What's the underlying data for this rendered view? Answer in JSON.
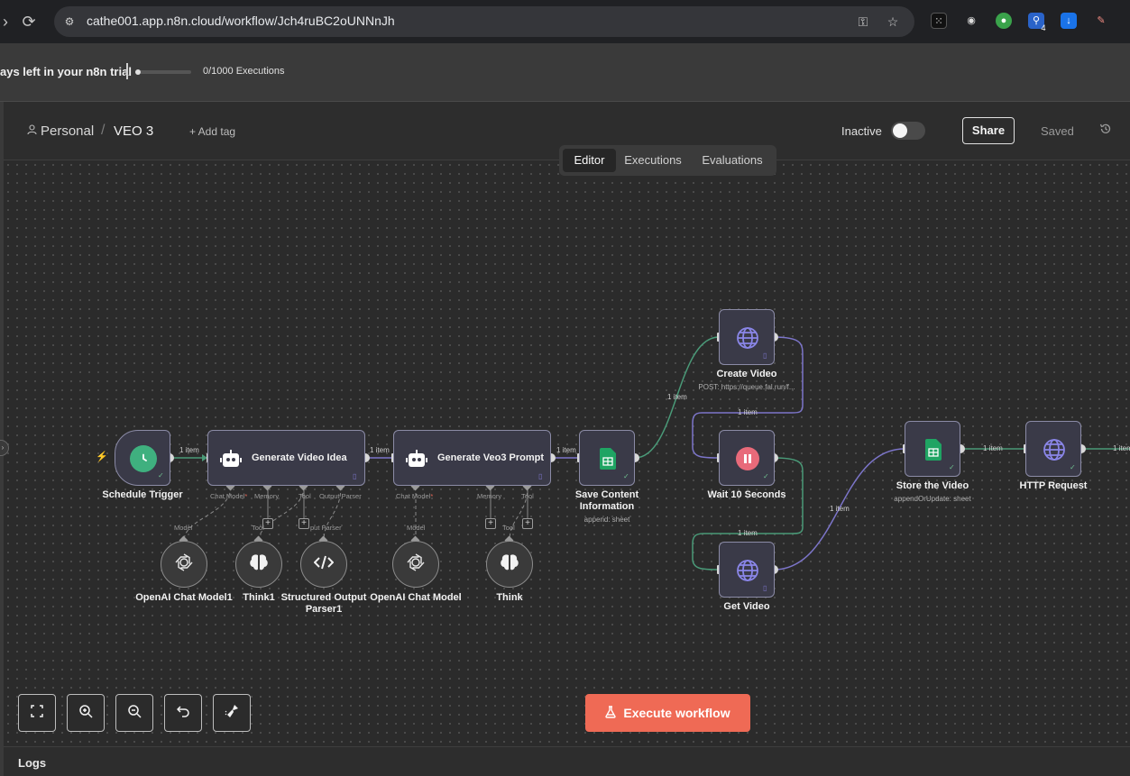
{
  "browser": {
    "url": "cathe001.app.n8n.cloud/workflow/Jch4ruBC2oUNNnJh",
    "badge_count": "4"
  },
  "trial": {
    "text": "ays left in your n8n trial",
    "executions": "0/1000 Executions",
    "progress": 0.0
  },
  "header": {
    "project": "Personal",
    "separator": "/",
    "workflow_name": "VEO 3",
    "add_tag": "+ Add tag",
    "status_label": "Inactive",
    "share": "Share",
    "saved": "Saved"
  },
  "tabs": [
    "Editor",
    "Executions",
    "Evaluations"
  ],
  "nodes": {
    "schedule_trigger": {
      "title": "Schedule Trigger"
    },
    "generate_video_idea": {
      "title": "Generate Video Idea"
    },
    "generate_veo3_prompt": {
      "title": "Generate Veo3 Prompt"
    },
    "save_content": {
      "title_line1": "Save Content",
      "title_line2": "Information",
      "subtitle": "append: sheet"
    },
    "create_video": {
      "title": "Create Video",
      "subtitle": "POST: https://queue.fal.run/f..."
    },
    "wait": {
      "title": "Wait 10 Seconds"
    },
    "get_video": {
      "title": "Get Video"
    },
    "store_video": {
      "title": "Store the Video",
      "subtitle": "appendOrUpdate: sheet"
    },
    "http_request": {
      "title": "HTTP Request"
    },
    "openai_model1": {
      "title": "OpenAI Chat Model1"
    },
    "think1": {
      "title": "Think1"
    },
    "structured_parser": {
      "title_line1": "Structured Output",
      "title_line2": "Parser1"
    },
    "openai_model": {
      "title": "OpenAI Chat Model"
    },
    "think": {
      "title": "Think"
    }
  },
  "ports": {
    "chat_model": "Chat Model",
    "required_star": "*",
    "memory": "Memory",
    "tool": "Tool",
    "output_parser": "Output Parser",
    "model": "Model",
    "parser_short": "put Parser"
  },
  "edge_label": "1 item",
  "controls": {
    "execute": "Execute workflow"
  },
  "logs": "Logs",
  "colors": {
    "accent": "#ef6a55",
    "edge_green": "#4a9a78",
    "edge_purple": "#7c75c9",
    "sheets_green": "#1fa463",
    "trigger_green": "#3fb07f",
    "wait_pink": "#e86a7a"
  }
}
